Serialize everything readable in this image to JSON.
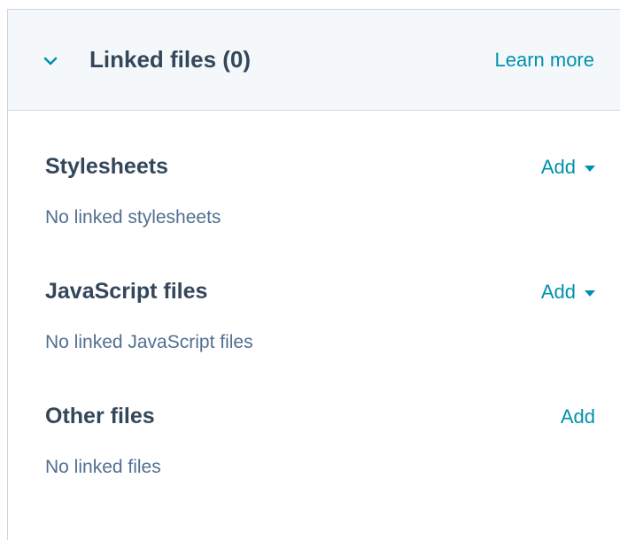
{
  "header": {
    "title": "Linked files (0)",
    "learn_more": "Learn more",
    "chevron_icon": "chevron-down-icon"
  },
  "sections": [
    {
      "title": "Stylesheets",
      "add_label": "Add",
      "has_dropdown": true,
      "empty_text": "No linked stylesheets"
    },
    {
      "title": "JavaScript files",
      "add_label": "Add",
      "has_dropdown": true,
      "empty_text": "No linked JavaScript files"
    },
    {
      "title": "Other files",
      "add_label": "Add",
      "has_dropdown": false,
      "empty_text": "No linked files"
    }
  ],
  "colors": {
    "accent": "#0091ae",
    "heading": "#33475b",
    "muted": "#516f90",
    "header_bg": "#f5f8fa",
    "border": "#cbd6e2"
  }
}
